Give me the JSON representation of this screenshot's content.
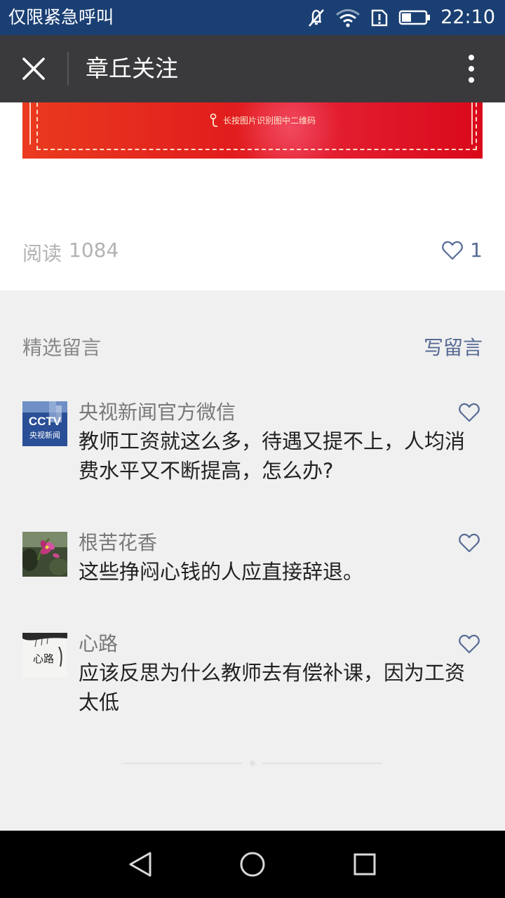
{
  "status_bar": {
    "carrier": "仅限紧急呼叫",
    "time": "22:10",
    "icons": [
      "mute-icon",
      "wifi-icon",
      "sim-alert-icon",
      "battery-icon"
    ]
  },
  "app_bar": {
    "title": "章丘关注",
    "close_icon": "close-icon",
    "more_icon": "more-vertical-icon"
  },
  "article": {
    "banner_text": "长按图片识别图中二维码",
    "read_label": "阅读",
    "read_count": "1084",
    "like_count": "1"
  },
  "comments": {
    "header_label": "精选留言",
    "write_label": "写留言",
    "items": [
      {
        "name": "央视新闻官方微信",
        "text": "教师工资就这么多，待遇又提不上，人均消费水平又不断提高，怎么办?",
        "avatar": {
          "kind": "cctv-logo",
          "brand": "CCTV",
          "caption": "央视新闻"
        }
      },
      {
        "name": "根苦花香",
        "text": "这些挣闷心钱的人应直接辞退。",
        "avatar": {
          "kind": "flower-photo"
        }
      },
      {
        "name": "心路",
        "text": "应该反思为什么教师去有偿补课，因为工资太低",
        "avatar": {
          "kind": "calligraphy",
          "caption": "心路"
        }
      }
    ]
  },
  "nav_bar": {
    "back_icon": "back-triangle-icon",
    "home_icon": "home-circle-icon",
    "recent_icon": "recents-square-icon"
  },
  "colors": {
    "status_bar": "#1a3f73",
    "app_bar": "#3a3a3d",
    "link": "#576b95",
    "banner_red": "#e11d1d"
  }
}
